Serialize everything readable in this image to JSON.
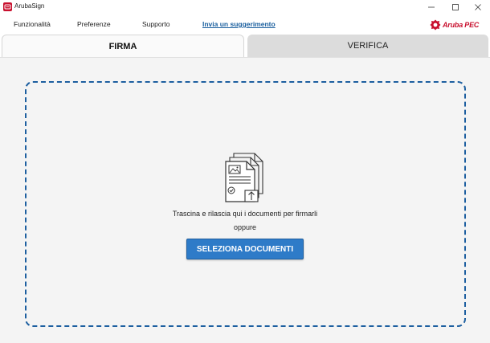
{
  "window": {
    "title": "ArubaSign"
  },
  "menu": {
    "items": [
      {
        "label": "Funzionalità"
      },
      {
        "label": "Preferenze"
      },
      {
        "label": "Supporto"
      }
    ],
    "suggestion_link": "Invia un suggerimento"
  },
  "brand": {
    "name": "Aruba PEC",
    "color": "#c8102e"
  },
  "tabs": [
    {
      "label": "FIRMA",
      "active": true
    },
    {
      "label": "VERIFICA",
      "active": false
    }
  ],
  "dropzone": {
    "icon": "documents-upload-icon",
    "instruction": "Trascina e rilascia qui i documenti per firmarli",
    "or_label": "oppure",
    "button_label": "SELEZIONA DOCUMENTI",
    "border_color": "#1d5fa0",
    "button_color": "#2e7bc8"
  }
}
